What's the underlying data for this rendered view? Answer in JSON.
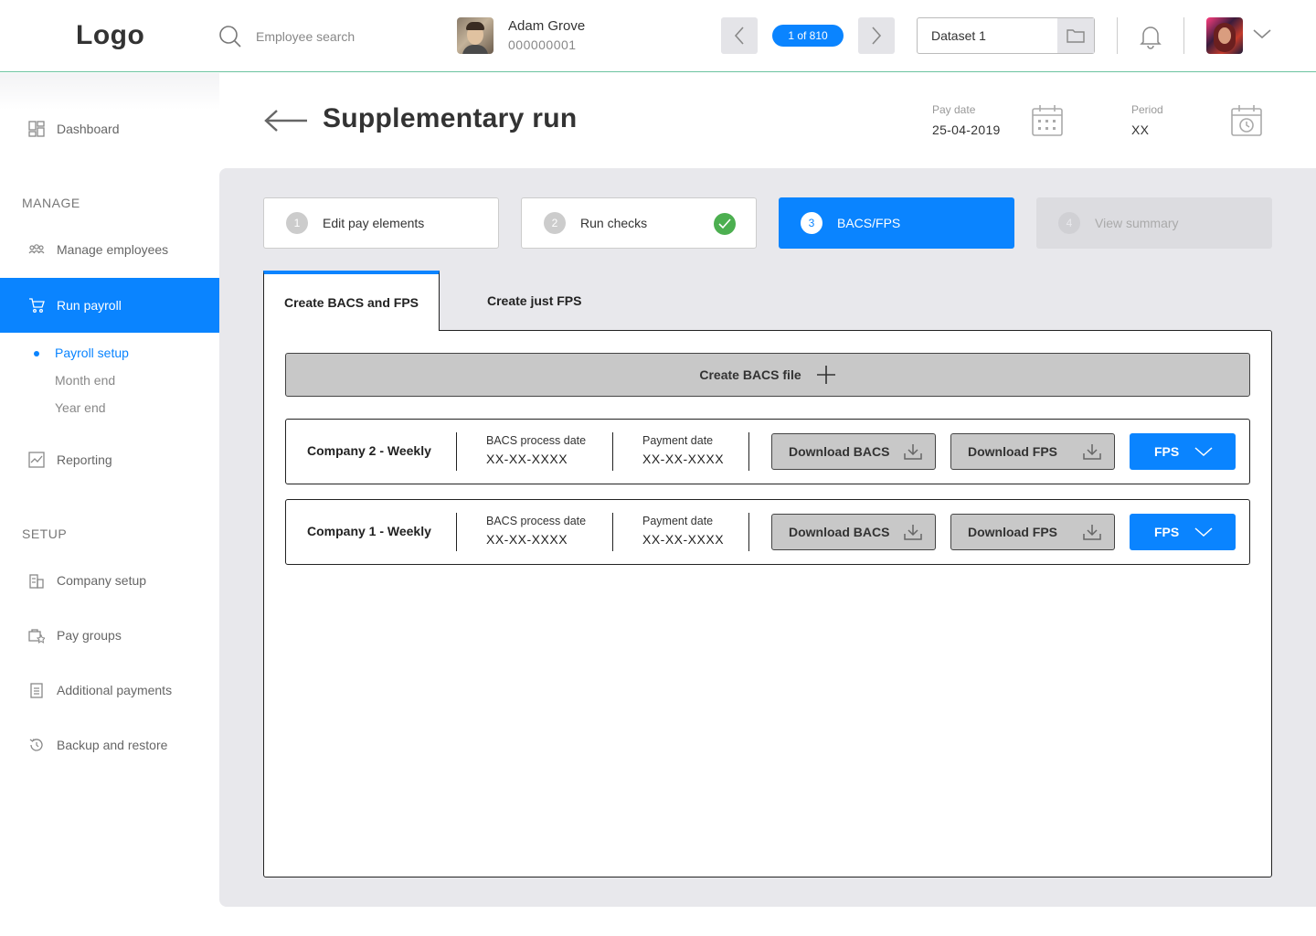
{
  "header": {
    "logo": "Logo",
    "search_placeholder": "Employee search",
    "employee_name": "Adam Grove",
    "employee_id": "000000001",
    "counter": "1 of 810",
    "dataset": "Dataset 1"
  },
  "sidebar": {
    "dashboard": "Dashboard",
    "manage_label": "MANAGE",
    "manage_employees": "Manage employees",
    "run_payroll": "Run payroll",
    "sub_items": [
      "Payroll setup",
      "Month end",
      "Year end"
    ],
    "reporting": "Reporting",
    "setup_label": "SETUP",
    "company_setup": "Company setup",
    "pay_groups": "Pay groups",
    "additional_payments": "Additional payments",
    "backup_restore": "Backup and restore"
  },
  "page": {
    "title": "Supplementary run",
    "pay_date_label": "Pay date",
    "pay_date": "25-04-2019",
    "period_label": "Period",
    "period": "XX"
  },
  "steps": [
    {
      "num": "1",
      "label": "Edit pay elements"
    },
    {
      "num": "2",
      "label": "Run checks"
    },
    {
      "num": "3",
      "label": "BACS/FPS"
    },
    {
      "num": "4",
      "label": "View summary"
    }
  ],
  "tabs": [
    "Create BACS and FPS",
    "Create just FPS"
  ],
  "create_bacs_label": "Create BACS file",
  "companies": [
    {
      "name": "Company 2 - Weekly",
      "bacs_label": "BACS process date",
      "bacs_date": "XX-XX-XXXX",
      "payment_label": "Payment date",
      "payment_date": "XX-XX-XXXX",
      "download_bacs": "Download BACS",
      "download_fps": "Download FPS",
      "fps": "FPS"
    },
    {
      "name": "Company 1 - Weekly",
      "bacs_label": "BACS process date",
      "bacs_date": "XX-XX-XXXX",
      "payment_label": "Payment date",
      "payment_date": "XX-XX-XXXX",
      "download_bacs": "Download BACS",
      "download_fps": "Download FPS",
      "fps": "FPS"
    }
  ],
  "colors": {
    "accent": "#0a84ff",
    "success": "#4caf50",
    "button_grey": "#c8c8c8",
    "panel_bg": "#e8e8ec"
  }
}
